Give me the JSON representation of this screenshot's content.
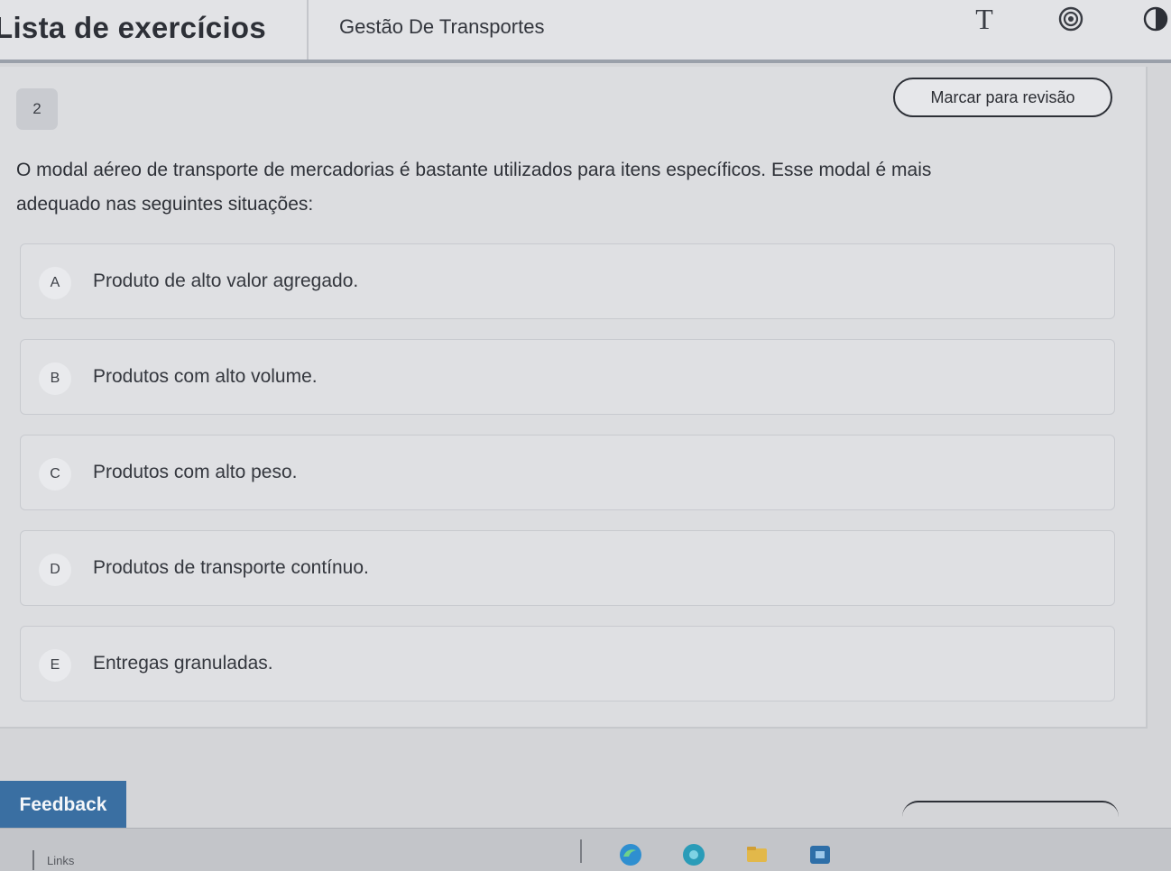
{
  "header": {
    "app_title": "Lista de exercícios",
    "course_title": "Gestão De Transportes",
    "font_icon_label": "T"
  },
  "question": {
    "number": "2",
    "review_label": "Marcar para revisão",
    "text_line1": "O modal aéreo de transporte de mercadorias é bastante utilizados para itens específicos. Esse modal é mais",
    "text_line2": "adequado nas seguintes situações:",
    "options": [
      {
        "letter": "A",
        "text": "Produto de alto valor agregado."
      },
      {
        "letter": "B",
        "text": "Produtos com alto volume."
      },
      {
        "letter": "C",
        "text": "Produtos com alto peso."
      },
      {
        "letter": "D",
        "text": "Produtos de transporte contínuo."
      },
      {
        "letter": "E",
        "text": "Entregas granuladas."
      }
    ]
  },
  "feedback": {
    "label": "Feedback"
  },
  "taskbar": {
    "links_label": "Links"
  },
  "colors": {
    "accent": "#3a6fa2",
    "background": "#d4d5d8"
  }
}
